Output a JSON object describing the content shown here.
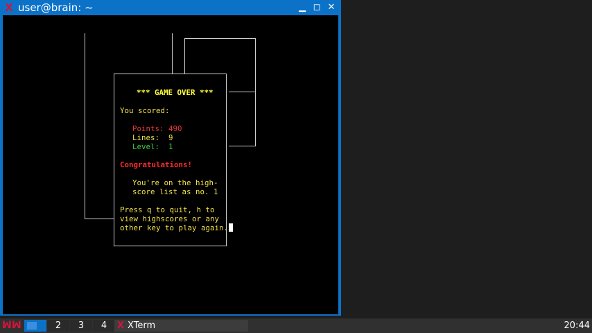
{
  "window": {
    "icon": "xterm-icon",
    "title": "user@brain: ~",
    "minimize_glyph": "▁",
    "maximize_glyph": "◻",
    "close_glyph": "✕"
  },
  "game_over": {
    "heading": "*** GAME OVER ***",
    "you_scored": "You scored:",
    "points": "Points: 490",
    "lines": "Lines:  9",
    "level": "Level:  1",
    "congrats": "Congratulations!",
    "highscore_line1": "You're on the high-",
    "highscore_line2": "score list as no. 1",
    "prompt_line1": "Press q to quit, h to",
    "prompt_line2": "view highscores or any",
    "prompt_line3": "other key to play again."
  },
  "taskbar": {
    "menu_icon": "openbox-menu-icon",
    "workspaces": [
      "",
      "2",
      "3",
      "4"
    ],
    "task_title": "XTerm",
    "clock": "20:44"
  },
  "colors": {
    "titlebar": "#0b72c8",
    "terminal_bg": "#000000",
    "text_yellow": "#f0e04a",
    "text_red": "#e83838",
    "text_green": "#3fd040"
  }
}
